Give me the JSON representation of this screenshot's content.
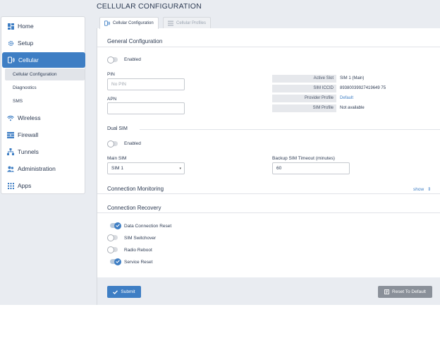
{
  "page_title": "CELLULAR CONFIGURATION",
  "sidebar": {
    "items": [
      {
        "label": "Home",
        "icon": "dashboard-icon"
      },
      {
        "label": "Setup",
        "icon": "gear-icon"
      },
      {
        "label": "Cellular",
        "icon": "cellular-icon"
      },
      {
        "label": "Wireless",
        "icon": "wifi-icon"
      },
      {
        "label": "Firewall",
        "icon": "firewall-icon"
      },
      {
        "label": "Tunnels",
        "icon": "tunnels-icon"
      },
      {
        "label": "Administration",
        "icon": "users-icon"
      },
      {
        "label": "Apps",
        "icon": "apps-icon"
      }
    ],
    "subitems": [
      {
        "label": "Cellular Configuration"
      },
      {
        "label": "Diagnostics"
      },
      {
        "label": "SMS"
      }
    ]
  },
  "tabs": [
    {
      "label": "Cellular Configuration"
    },
    {
      "label": "Cellular Profiles"
    }
  ],
  "general": {
    "title": "General Configuration",
    "enabled_label": "Enabled",
    "pin_label": "PIN",
    "pin_placeholder": "No PIN",
    "apn_label": "APN",
    "apn_value": "",
    "info": [
      {
        "key": "Active Slot",
        "value": "SIM 1 (Main)"
      },
      {
        "key": "SIM ICCID",
        "value": "89380039927419649 75"
      },
      {
        "key": "Provider Profile",
        "value": "Default"
      },
      {
        "key": "SIM Profile",
        "value": "Not available"
      }
    ]
  },
  "dual_sim": {
    "title": "Dual SIM",
    "enabled_label": "Enabled",
    "main_sim_label": "Main SIM",
    "main_sim_value": "SIM 1",
    "backup_timeout_label": "Backup SIM Timeout (minutes)",
    "backup_timeout_value": "60"
  },
  "monitoring": {
    "title": "Connection Monitoring",
    "show_label": "show"
  },
  "recovery": {
    "title": "Connection Recovery",
    "options": [
      {
        "label": "Data Connection Reset",
        "on": true
      },
      {
        "label": "SIM Switchover",
        "on": false
      },
      {
        "label": "Radio Reboot",
        "on": false
      },
      {
        "label": "Service Reset",
        "on": true
      }
    ]
  },
  "footer": {
    "submit_label": "Submit",
    "reset_label": "Reset To Default"
  },
  "colors": {
    "accent": "#3e7ec4",
    "background": "#e9ecf1",
    "text": "#2c3a52"
  }
}
